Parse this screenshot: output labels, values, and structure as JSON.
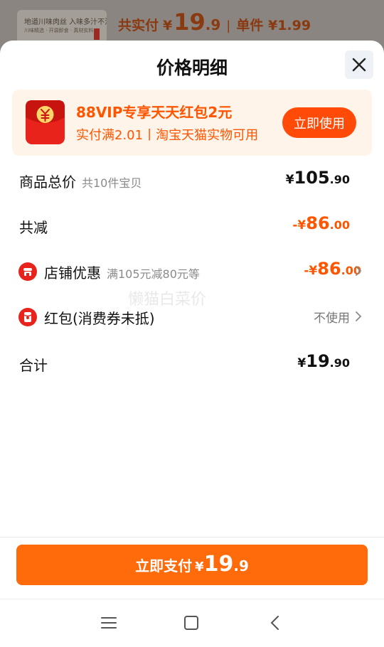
{
  "peek": {
    "thumb_line1": "地道川味肉丝 入味多汁不油腻",
    "thumb_line2": "川味精选 · 开袋即食 · 真材实料",
    "total_label": "共实付",
    "currency": "¥",
    "total_int": "19",
    "total_dec": ".9",
    "separator": "|",
    "unit_label": "单件 ¥1.99"
  },
  "sheet": {
    "title": "价格明细",
    "close_icon": "close-icon"
  },
  "vip_banner": {
    "icon": "red-envelope-yuan-icon",
    "title": "88VIP专享天天红包2元",
    "subtitle": "实付满2.01丨淘宝天猫实物可用",
    "button": "立即使用",
    "accent": "#ff5500",
    "button_color": "#ff4a08"
  },
  "rows": {
    "goods_total": {
      "label": "商品总价",
      "sub": "共10件宝贝",
      "prefix": "¥",
      "int": "105",
      "dec": ".90"
    },
    "reduction": {
      "label": "共减",
      "prefix": "-¥",
      "int": "86",
      "dec": ".00"
    },
    "shop_discount": {
      "icon": "shop-icon",
      "label": "店铺优惠",
      "sub": "满105元减80元等",
      "prefix": "-¥",
      "int": "86",
      "dec": ".00"
    },
    "red_packet": {
      "icon": "red-packet-icon",
      "label": "红包(消费券未抵)",
      "value": "不使用"
    },
    "total": {
      "label": "合计",
      "prefix": "¥",
      "int": "19",
      "dec": ".90"
    }
  },
  "watermark": "懒猫白菜价",
  "pay": {
    "label": "立即支付",
    "currency": "¥",
    "int": "19",
    "dec": ".9",
    "color": "#ff6a0a"
  },
  "navbar": {
    "menu_icon": "menu-icon",
    "home_icon": "home-icon",
    "back_icon": "back-icon"
  }
}
